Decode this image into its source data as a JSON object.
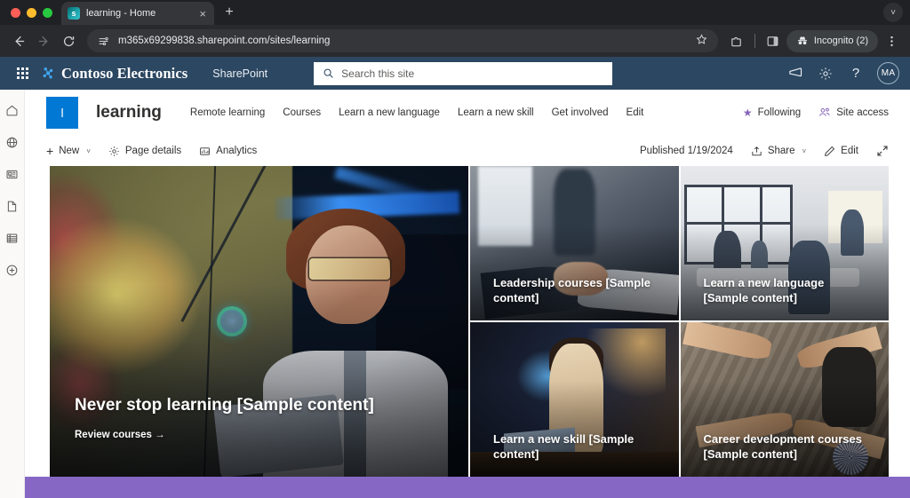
{
  "browser": {
    "tab": {
      "title": "learning - Home",
      "favicon": "sharepoint-icon",
      "favicon_letter": "s",
      "close": "×"
    },
    "new_tab": "+",
    "tabstrip_chevron": "˅",
    "nav": {
      "back": "back-arrow-icon",
      "forward": "forward-arrow-icon",
      "reload": "reload-icon"
    },
    "omnibox": {
      "url": "m365x69299838.sharepoint.com/sites/learning",
      "site_info_icon": "tune-icon",
      "bookmark_icon": "star-icon"
    },
    "actions": {
      "extensions": "extensions-icon",
      "split_view": "side-panel-icon",
      "incognito_label": "Incognito (2)",
      "incognito_icon": "incognito-hat-icon",
      "menu": "kebab-menu-icon"
    }
  },
  "suitebar": {
    "waffle": "app-launcher-icon",
    "brand": "Contoso Electronics",
    "app": "SharePoint",
    "search_placeholder": "Search this site",
    "search_icon": "search-icon",
    "icons": [
      "megaphone-icon",
      "gear-icon",
      "help-icon"
    ],
    "avatar_initials": "MA"
  },
  "rail": {
    "items": [
      {
        "name": "home-icon"
      },
      {
        "name": "globe-icon"
      },
      {
        "name": "news-icon"
      },
      {
        "name": "page-icon"
      },
      {
        "name": "list-icon"
      },
      {
        "name": "create-icon"
      }
    ]
  },
  "site": {
    "logo_letter": "l",
    "title": "learning",
    "nav": [
      "Remote learning",
      "Courses",
      "Learn a new language",
      "Learn a new skill",
      "Get involved",
      "Edit"
    ],
    "following_label": "Following",
    "following_icon": "star-filled-icon",
    "site_access_label": "Site access",
    "site_access_icon": "people-icon"
  },
  "commandbar": {
    "new_label": "New",
    "new_icon": "plus-icon",
    "new_chevron": "˅",
    "page_details_label": "Page details",
    "page_details_icon": "gear-icon",
    "analytics_label": "Analytics",
    "analytics_icon": "analytics-icon",
    "published": "Published 1/19/2024",
    "share_label": "Share",
    "share_icon": "share-icon",
    "share_chevron": "˅",
    "edit_label": "Edit",
    "edit_icon": "pencil-icon",
    "expand_icon": "full-screen-icon"
  },
  "hero": {
    "main": {
      "title": "Never stop learning [Sample content]",
      "cta": "Review courses →",
      "image": "scientist-viewing-data-visualization"
    },
    "tiles": [
      {
        "title": "Leadership courses [Sample content]",
        "image": "business-handshake"
      },
      {
        "title": "Learn a new language [Sample content]",
        "image": "classroom-discussion"
      },
      {
        "title": "Learn a new skill [Sample content]",
        "image": "woman-working-on-laptop"
      },
      {
        "title": "Career development courses [Sample content]",
        "image": "team-hands-together"
      }
    ]
  },
  "colors": {
    "suitebar": "#2c4761",
    "site_logo": "#0078d4",
    "accent_purple": "#8764b8",
    "bottom_band": "#8668c4"
  }
}
